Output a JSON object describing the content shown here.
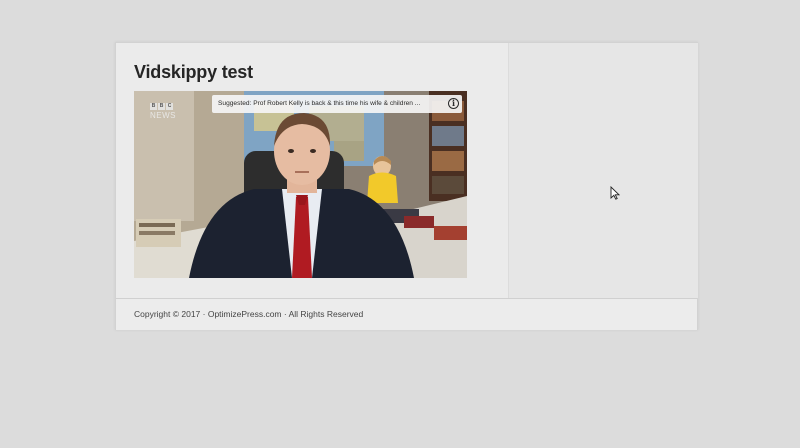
{
  "post": {
    "title": "Vidskippy test"
  },
  "video": {
    "suggested_text": "Suggested: Prof Robert Kelly is back & this time his wife & children ...",
    "info_icon": "info-icon",
    "logo": {
      "bbc_letters": [
        "B",
        "B",
        "C"
      ],
      "news_label": "NEWS"
    }
  },
  "footer": {
    "copyright": "Copyright © 2017 · OptimizePress.com · All Rights Reserved"
  },
  "cursor": {
    "icon": "mouse-pointer-icon"
  },
  "colors": {
    "page_background": "#dcdcdc",
    "card_background": "#e9e9e9",
    "title_text": "#252525",
    "footer_text": "#444444"
  }
}
